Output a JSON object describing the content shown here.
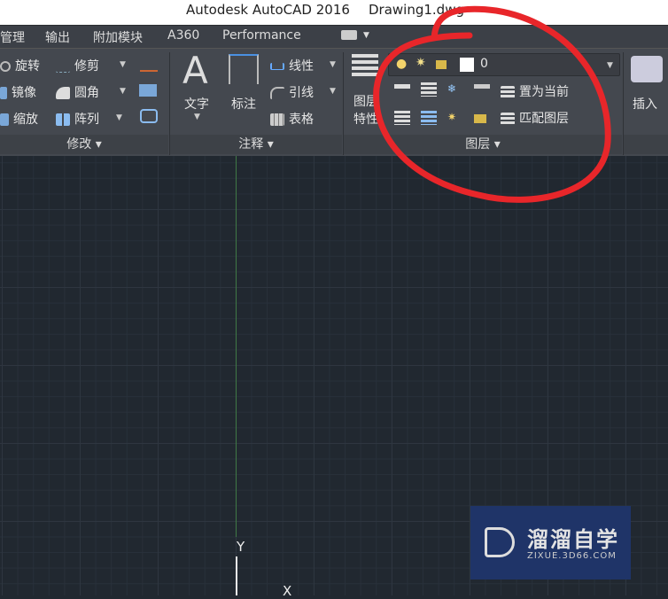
{
  "title_bar": {
    "app": "Autodesk AutoCAD 2016",
    "file": "Drawing1.dwg"
  },
  "tabs": [
    "管理",
    "输出",
    "附加模块",
    "A360",
    "Performance"
  ],
  "modify_panel": {
    "label": "修改",
    "items": [
      "旋转",
      "镜像",
      "缩放",
      "修剪",
      "圆角",
      "阵列"
    ]
  },
  "annotation_panel": {
    "label": "注释",
    "text": "文字",
    "dimension": "标注",
    "items": [
      "线性",
      "引线",
      "表格"
    ]
  },
  "layers_panel": {
    "label": "图层",
    "properties": "图层特性",
    "current_layer": "0",
    "set_current": "置为当前",
    "match_layer": "匹配图层"
  },
  "insert": {
    "label": "插入"
  },
  "ucs": {
    "y": "Y",
    "x": "X"
  },
  "watermark": {
    "name": "溜溜自学",
    "url": "ZIXUE.3D66.COM"
  },
  "colors": {
    "annotation": "#e8262a",
    "canvas": "#212830",
    "ribbon": "#44484f"
  }
}
